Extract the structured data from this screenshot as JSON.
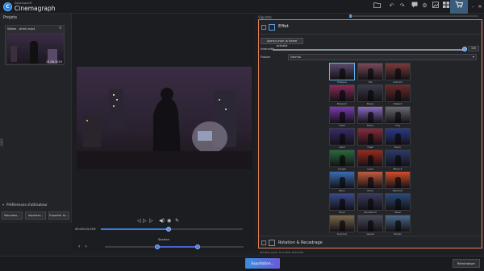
{
  "app": {
    "brand_sub": "Ashampoo®",
    "brand_main": "Cinemagraph",
    "logo_letter": "C"
  },
  "toolbar": {
    "icons": [
      "folder-icon",
      "undo-icon",
      "redo-icon",
      "chat-icon",
      "settings-icon",
      "image-icon",
      "grid-icon",
      "cart-icon"
    ],
    "minimize": "–",
    "maximize": "▢",
    "close": "✕"
  },
  "left": {
    "projects_title": "Projets",
    "thumb": {
      "name": "Wales - drink.mp4",
      "date": "23.06.2019",
      "close": "×"
    },
    "prefs_title": "Préférences d'utilisateur",
    "buttons": [
      "Nouveau...",
      "Importer...",
      "Exporter to..."
    ]
  },
  "player": {
    "controls": [
      "◁",
      "▷",
      "▷",
      "◀)",
      "◉",
      "✎"
    ],
    "time": "00:00:04.559",
    "progress": 0.48,
    "section_label": "Section",
    "section_start": 0.38,
    "section_end": 0.67,
    "prev": "‹",
    "next": "›"
  },
  "right": {
    "top_label": "Vignette",
    "effect_title": "Effet",
    "apply_label": "Aperçu avec la frame actuelle",
    "intensity_label": "Intensité",
    "intensity_value": "100",
    "intensity": 1.0,
    "blend_label": "Fusion",
    "blend_value": "Normal",
    "effects": [
      {
        "label": "Masque",
        "color": "#5b4a6e",
        "selected": true
      },
      {
        "label": "70s",
        "color": "#7a4a5a"
      },
      {
        "label": "Autumn",
        "color": "#7a3a3a"
      },
      {
        "label": "Blossom",
        "color": "#8a2a5a"
      },
      {
        "label": "Blues",
        "color": "#3a3a4a"
      },
      {
        "label": "Distant",
        "color": "#6a2a2a"
      },
      {
        "label": "Flash",
        "color": "#7a3ab0"
      },
      {
        "label": "Faery",
        "color": "#8a6ac0"
      },
      {
        "label": "Fog",
        "color": "#6a6a72"
      },
      {
        "label": "Glow",
        "color": "#3a2a6a"
      },
      {
        "label": "Heat",
        "color": "#8a2a3a"
      },
      {
        "label": "Moon",
        "color": "#2a3a8a"
      },
      {
        "label": "Jungle",
        "color": "#2a6a3a"
      },
      {
        "label": "Lava",
        "color": "#9a2a1a"
      },
      {
        "label": "Moon II",
        "color": "#2a3a6a"
      },
      {
        "label": "Neon",
        "color": "#3a6ab0"
      },
      {
        "label": "Pluie",
        "color": "#c05a3a"
      },
      {
        "label": "Rainbow",
        "color": "#d04a2a"
      },
      {
        "label": "Rose",
        "color": "#3a4a8a"
      },
      {
        "label": "Sandstorm",
        "color": "#3a3a5a"
      },
      {
        "label": "Steel",
        "color": "#2a4a7a"
      },
      {
        "label": "Summer",
        "color": "#7a6a4a"
      },
      {
        "label": "Velvet",
        "color": "#4a4a5a"
      },
      {
        "label": "Winter",
        "color": "#4a6a8a"
      }
    ],
    "rotation_title": "Rotation & Recadrage",
    "below_text": "Actions pour la frame actuelle"
  },
  "footer": {
    "export": "Exportation...",
    "reset": "Réinitialiser"
  }
}
